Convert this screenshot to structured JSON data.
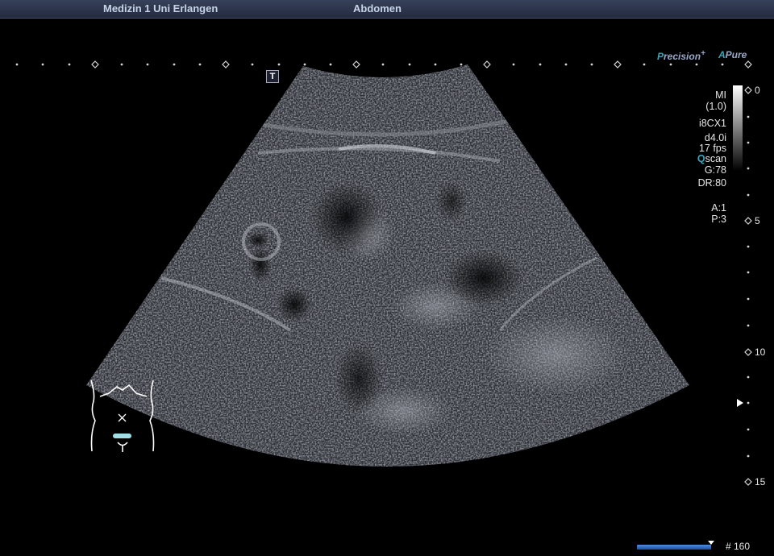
{
  "header": {
    "institution": "Medizin 1 Uni Erlangen",
    "exam": "Abdomen"
  },
  "branding": {
    "precision_p": "P",
    "precision_rest": "recision",
    "precision_plus": "+",
    "pure_a": "A",
    "pure_rest": "Pure"
  },
  "marker": {
    "t_label": "T"
  },
  "params": {
    "mi_label": "MI",
    "mi_value": "(1.0)",
    "probe": "i8CX1",
    "depth_freq": "d4.0i",
    "frame_rate": "17 fps",
    "qscan_q": "Q",
    "qscan_rest": "scan",
    "gain": "G:78",
    "dynamic_range": "DR:80",
    "a_val": "A:1",
    "p_val": "P:3"
  },
  "depth_scale": {
    "labels": [
      "0",
      "5",
      "10",
      "15"
    ],
    "unit": "cm"
  },
  "cine": {
    "frame_label": "# 160"
  },
  "colors": {
    "accent_cyan": "#3fa3b8",
    "header_text": "#c9d3e8",
    "bodymark_probe": "#9fe0e8"
  }
}
